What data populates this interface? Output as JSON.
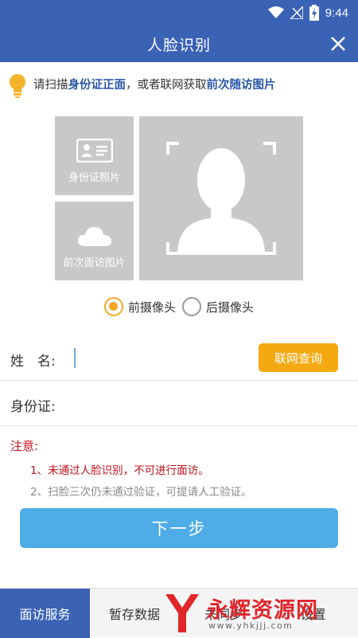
{
  "status_bar": {
    "time": "9:44",
    "icons": [
      "wifi-icon",
      "signal-off-icon",
      "battery-charging-icon"
    ]
  },
  "header": {
    "title": "人脸识别",
    "close_icon": "close-icon"
  },
  "hint": {
    "icon": "lightbulb-icon",
    "part1": "请扫描",
    "highlight1": "身份证正面",
    "part2": "，或者联网获取",
    "highlight2": "前次随访图片"
  },
  "photos": {
    "id_card_label": "身份证照片",
    "previous_visit_label": "前次面访图片"
  },
  "camera": {
    "front_label": "前摄像头",
    "rear_label": "后摄像头",
    "selected": "front"
  },
  "form": {
    "name_label": "姓　名:",
    "name_value": "",
    "query_button": "联网查询",
    "id_label": "身份证:",
    "id_value": ""
  },
  "notice": {
    "title": "注意:",
    "item1": "1、未通过人脸识别，不可进行面访。",
    "item2": "2、扫脸三次仍未通过验证，可提请人工验证。"
  },
  "next_button": "下一步",
  "tabs": [
    {
      "label": "面访服务",
      "active": true
    },
    {
      "label": "暂存数据",
      "active": false
    },
    {
      "label": "未同步",
      "active": false
    },
    {
      "label": "设置",
      "active": false
    }
  ],
  "watermark": {
    "text": "永辉资源网",
    "url": "www.yhkjjj.com"
  },
  "colors": {
    "primary": "#3a63b5",
    "accent": "#f5a910",
    "next_button": "#4eace6",
    "warning": "#c0101a"
  }
}
